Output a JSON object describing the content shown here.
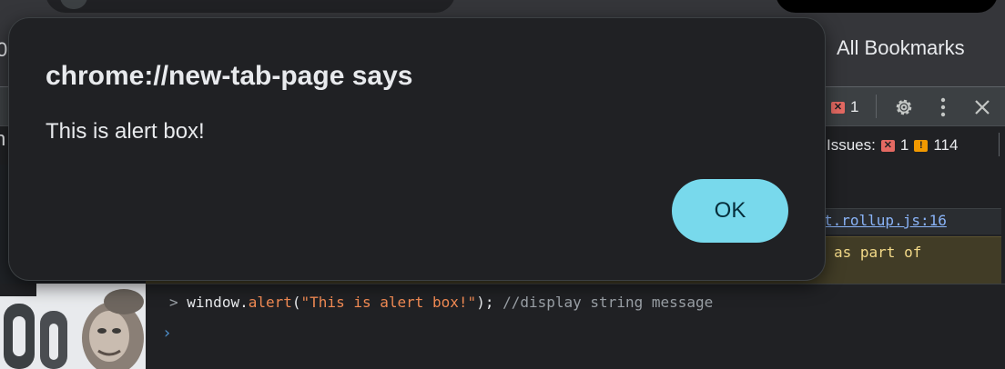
{
  "browser": {
    "bookmarks_left_fragment": "0",
    "all_bookmarks_label": "All Bookmarks"
  },
  "devtools": {
    "error_count": "1",
    "issues": {
      "label": "Issues:",
      "error_count": "1",
      "warning_count": "114"
    },
    "left_edge_fragment": "n",
    "source_link": "t.rollup.js:16",
    "warning_fragment": "as part of",
    "console": {
      "prompt_symbol": ">",
      "command": {
        "object": "window.",
        "method": "alert",
        "open_paren": "(",
        "string_arg": "\"This is alert box!\"",
        "close": ");",
        "comment": "//display string message"
      },
      "input_caret": "›"
    }
  },
  "dialog": {
    "title": "chrome://new-tab-page says",
    "message": "This is alert box!",
    "ok_label": "OK"
  },
  "colors": {
    "dialog_bg": "#202124",
    "ok_button": "#78d9ec",
    "error_badge": "#e46962",
    "warning_badge": "#f29900",
    "console_method": "#f28b54"
  }
}
